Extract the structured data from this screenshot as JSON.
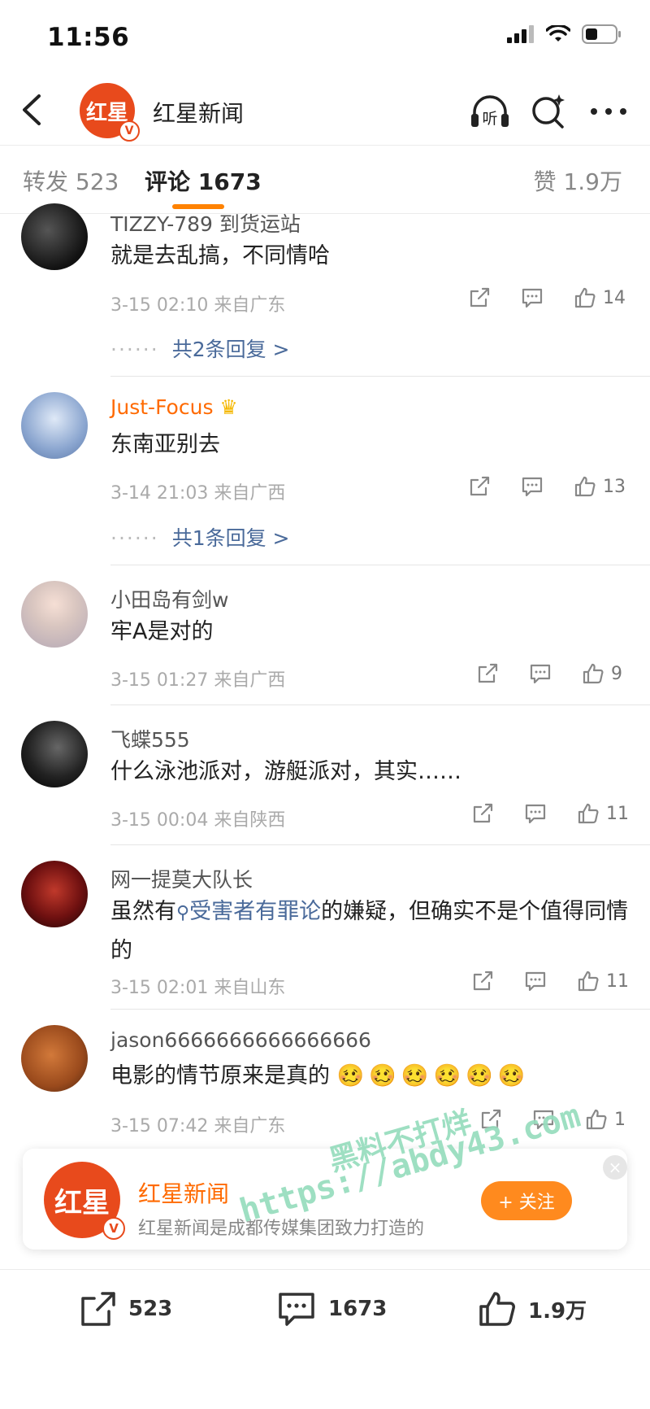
{
  "status_bar": {
    "time": "11:56"
  },
  "header": {
    "title": "红星新闻",
    "logo_text": "红星",
    "badge": "V",
    "listen_label": "听"
  },
  "tabs": [
    {
      "label": "转发 523"
    },
    {
      "label": "评论 1673"
    },
    {
      "label": "赞 1.9万"
    }
  ],
  "comments": [
    {
      "user": "TIZZY-789 到货运站",
      "text": "就是去乱搞，不同情哈",
      "meta": "3-15 02:10 来自广东",
      "likes": "14",
      "replies": "共2条回复 >"
    },
    {
      "user": "Just-Focus",
      "text": "东南亚别去",
      "meta": "3-14 21:03 来自广西",
      "likes": "13",
      "replies": "共1条回复 >"
    },
    {
      "user": "小田岛有剑w",
      "text": "牢A是对的",
      "meta": "3-15 01:27 来自广西",
      "likes": "9"
    },
    {
      "user": "飞蝶555",
      "text": "什么泳池派对，游艇派对，其实……",
      "meta": "3-15 00:04 来自陕西",
      "likes": "11"
    },
    {
      "user": "网一提莫大队长",
      "text_before": "虽然有",
      "topic": "受害者有罪论",
      "text_after": "的嫌疑，但确实不是个值得同情的",
      "meta": "3-15 02:01 来自山东",
      "likes": "11"
    },
    {
      "user": "jason6666666666666666",
      "text": "电影的情节原来是真的",
      "meta": "3-15 07:42 来自广东",
      "likes": "1"
    }
  ],
  "promo": {
    "name": "红星新闻",
    "description": "红星新闻是成都传媒集团致力打造的",
    "follow_label": "+ 关注",
    "close": "×"
  },
  "bottom_bar": {
    "repost_count": "523",
    "comment_count": "1673",
    "like_count": "1.9万"
  },
  "watermark": {
    "line1": "黑料不打烊",
    "line2": "https://abdy43.com"
  },
  "colors": {
    "accent": "#ff8200",
    "username_highlight": "#ff6a00",
    "link": "#4a6a9a",
    "brand": "#e84a1c"
  }
}
